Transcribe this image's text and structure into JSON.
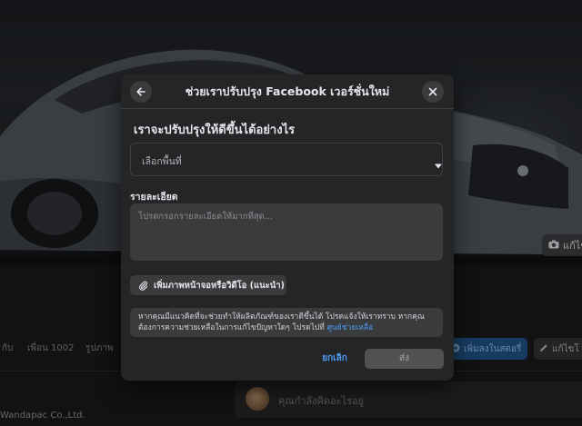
{
  "background": {
    "cover_button_label": "แก้ไข",
    "tabs": [
      {
        "label": "กับ"
      },
      {
        "label": "เพื่อน 1002"
      },
      {
        "label": "รูปภาพ"
      }
    ],
    "add_story_label": "เพิ่มลงในสตอรี่",
    "edit_label": "แก้ไขโ",
    "company_name": "Wandapac Co.,Ltd.",
    "composer_placeholder": "คุณกำลังคิดอะไรอยู่"
  },
  "modal": {
    "title": "ช่วยเราปรับปรุง Facebook เวอร์ชั่นใหม่",
    "question": "เราจะปรับปรุงให้ดีขึ้นได้อย่างไร",
    "select": {
      "value": "เลือกพื้นที่"
    },
    "details": {
      "label": "รายละเอียด",
      "placeholder": "โปรดกรอกรายละเอียดให้มากที่สุด..."
    },
    "attach_label": "เพิ่มภาพหน้าจอหรือวิดีโอ (แนะนำ)",
    "notice": {
      "text": "หากคุณมีแนวคิดที่จะช่วยทำให้ผลิตภัณฑ์ของเราดีขึ้นได้ โปรดแจ้งให้เราทราบ หากคุณต้องการความช่วยเหลือในการแก้ไขปัญหาใดๆ โปรดไปที่",
      "link": "ศูนย์ช่วยเหลือ"
    },
    "cancel_label": "ยกเลิก",
    "submit_label": "ส่ง"
  },
  "colors": {
    "modal_bg": "#242526",
    "field_bg": "#3a3b3c",
    "link": "#4d9cf5",
    "text": "#e4e6eb",
    "muted": "#b0b3b8",
    "disabled_button": "#505151"
  },
  "icons": [
    "back-arrow-icon",
    "close-icon",
    "caret-down-icon",
    "paperclip-icon",
    "camera-icon",
    "plus-icon",
    "pencil-icon"
  ]
}
